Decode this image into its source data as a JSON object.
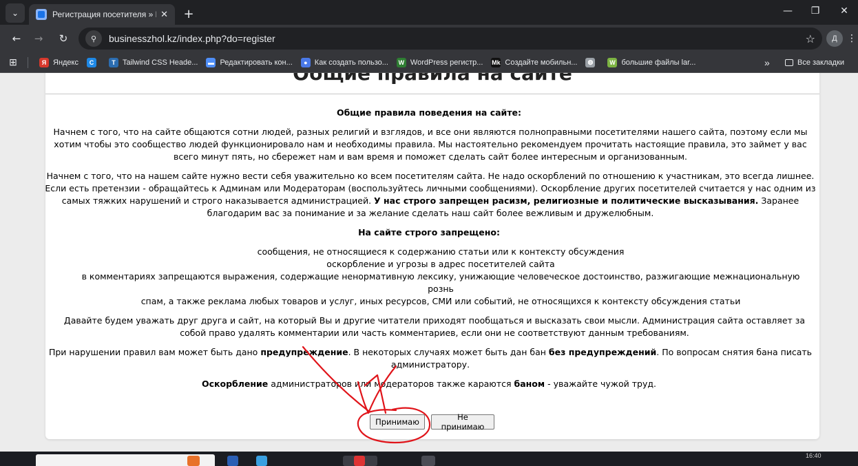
{
  "browser": {
    "tab_title": "Регистрация посетителя » Busi",
    "url": "businesszhol.kz/index.php?do=register",
    "profile_initial": "Д",
    "bookmarks": [
      {
        "label": "Яндекс",
        "icon": "yandex-icon",
        "color": "#d6382c",
        "glyph": "Я"
      },
      {
        "label": "",
        "icon": "c-icon",
        "color": "#1e88e5",
        "glyph": "C"
      },
      {
        "label": "Tailwind CSS Heade...",
        "icon": "tailwind-icon",
        "color": "#2b6cb0",
        "glyph": "T"
      },
      {
        "label": "Редактировать кон...",
        "icon": "chat-icon",
        "color": "#4f8ef7",
        "glyph": "▬"
      },
      {
        "label": "Как создать пользо...",
        "icon": "circle-icon",
        "color": "#4a79e8",
        "glyph": "●"
      },
      {
        "label": "WordPress регистр...",
        "icon": "wordpress-icon",
        "color": "#2e7d32",
        "glyph": "W"
      },
      {
        "label": "Создайте мобильн...",
        "icon": "mk-icon",
        "color": "#111111",
        "glyph": "Mk"
      },
      {
        "label": "",
        "icon": "globe-icon",
        "color": "#9aa0a6",
        "glyph": "◍"
      },
      {
        "label": "большие файлы lar...",
        "icon": "wp-icon",
        "color": "#7cb342",
        "glyph": "W"
      }
    ],
    "all_bookmarks": "Все закладки"
  },
  "page": {
    "heading": "Общие правила на сайте",
    "behavior_title": "Общие правила поведения на сайте",
    "para1": "Начнем с того, что на сайте общаются сотни людей, разных религий и взглядов, и все они являются полноправными посетителями нашего сайта, поэтому если мы хотим чтобы это сообщество людей функционировало нам и необходимы правила. Мы настоятельно рекомендуем прочитать настоящие правила, это займет у вас всего минут пять, но сбережет нам и вам время и поможет сделать сайт более интересным и организованным.",
    "para2_start": "Начнем с того, что на нашем сайте нужно вести себя уважительно ко всем посетителям сайта. Не надо оскорблений по отношению к участникам, это всегда лишнее. Если есть претензии - обращайтесь к Админам или Модераторам (воспользуйтесь личными сообщениями). Оскорбление других посетителей считается у нас одним из самых тяжких нарушений и строго наказывается администрацией.",
    "para2_bold": "У нас строго запрещен расизм, религиозные и политические высказывания.",
    "para2_end": "Заранее благодарим вас за понимание и за желание сделать наш сайт более вежливым и дружелюбным.",
    "forbidden_title": "На сайте строго запрещено",
    "forbidden_items": [
      "сообщения, не относящиеся к содержанию статьи или к контексту обсуждения",
      "оскорбление и угрозы в адрес посетителей сайта",
      "в комментариях запрещаются выражения, содержащие ненормативную лексику, унижающие человеческое достоинство, разжигающие межнациональную рознь",
      "спам, а также реклама любых товаров и услуг, иных ресурсов, СМИ или событий, не относящихся к контексту обсуждения статьи"
    ],
    "respect": "Давайте будем уважать друг друга и сайт, на который Вы и другие читатели приходят пообщаться и высказать свои мысли. Администрация сайта оставляет за собой право удалять комментарии или часть комментариев, если они не соответствуют данным требованиям.",
    "violation_1": "При нарушении правил вам может быть дано",
    "violation_warning": "предупреждение",
    "violation_2": ". В некоторых случаях может быть дан бан",
    "violation_nowarn": "без предупреждений",
    "violation_3": ". По вопросам снятия бана писать администратору.",
    "insult_bold": "Оскорбление",
    "insult_mid": "администраторов или модераторов также караются",
    "insult_ban": "баном",
    "insult_end": "- уважайте чужой труд.",
    "accept_button": "Принимаю",
    "decline_button": "Не принимаю"
  },
  "taskbar": {
    "time": "16:40"
  },
  "colors": {
    "annotation": "#e0141a",
    "chrome_dark": "#202124",
    "chrome_mid": "#35363a"
  }
}
